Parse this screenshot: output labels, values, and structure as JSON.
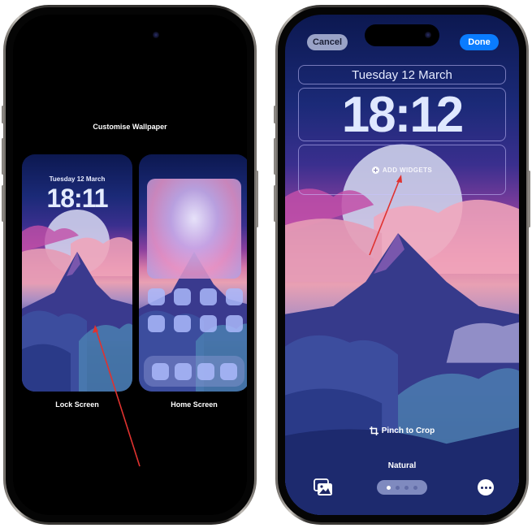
{
  "left_phone": {
    "title": "Customise Wallpaper",
    "lock_preview": {
      "date": "Tuesday 12 March",
      "time": "18:11",
      "label": "Lock Screen"
    },
    "home_preview": {
      "label": "Home Screen",
      "app_rows": 2,
      "apps_per_row": 4,
      "dock_apps": 4
    }
  },
  "right_phone": {
    "cancel_label": "Cancel",
    "done_label": "Done",
    "date": "Tuesday 12 March",
    "time": "18:12",
    "add_widgets_label": "ADD WIDGETS",
    "crop_hint": "Pinch to Crop",
    "style_name": "Natural",
    "page_count": 4,
    "active_page": 1
  },
  "colors": {
    "accent_blue": "#0a7cff",
    "cancel_bg": "#9aa3c7",
    "annotation_red": "#e0322f"
  },
  "icons": {
    "add": "plus-circle-icon",
    "crop": "crop-icon",
    "photos": "photo-library-icon",
    "more": "ellipsis-circle-icon"
  }
}
